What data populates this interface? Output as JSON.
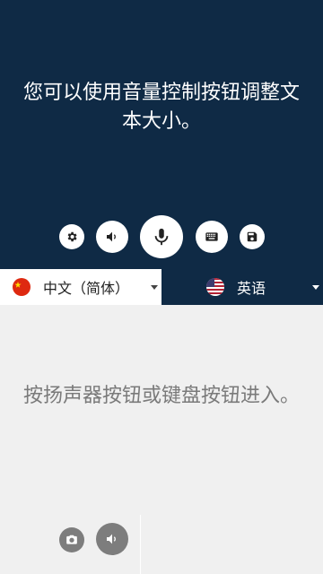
{
  "top": {
    "text": "您可以使用音量控制按钮调整文本大小。",
    "controls": {
      "settings_icon": "gear-icon",
      "speaker_icon": "speaker-icon",
      "mic_icon": "microphone-icon",
      "keyboard_icon": "keyboard-icon",
      "save_icon": "save-icon"
    }
  },
  "language_bar": {
    "source": {
      "label": "中文（简体）",
      "flag": "china-flag-icon"
    },
    "target": {
      "label": "英语",
      "flag": "us-flag-icon"
    }
  },
  "bottom": {
    "text": "按扬声器按钮或键盘按钮进入。",
    "controls": {
      "camera_icon": "camera-icon",
      "speaker_icon": "speaker-icon"
    }
  },
  "colors": {
    "dark_navy": "#0f2a45",
    "light_gray": "#f0f0f0",
    "button_gray": "#7d7d7d",
    "placeholder_text": "#7a7a7a"
  }
}
